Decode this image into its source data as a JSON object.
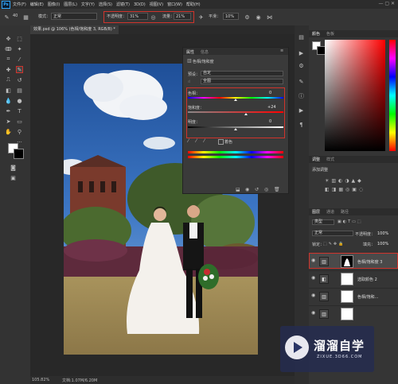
{
  "app_logo": "Ps",
  "menu": [
    "文件(F)",
    "编辑(E)",
    "图像(I)",
    "图层(L)",
    "文字(Y)",
    "选择(S)",
    "滤镜(T)",
    "3D(D)",
    "视图(V)",
    "窗口(W)",
    "帮助(H)"
  ],
  "options": {
    "brush_size": "40",
    "mode_label": "模式：",
    "mode_value": "正常",
    "opacity_label": "不透明度：",
    "opacity_value": "31%",
    "flow_label": "流量：",
    "flow_value": "21%",
    "smooth_label": "平滑：",
    "smooth_value": "10%"
  },
  "document": {
    "tab_title": "效果.psd @ 106% (色相/饱和度 3, RGB/8) *",
    "zoom": "105.82%",
    "doc_size": "文档:1.07M/6.20M"
  },
  "hue_panel": {
    "tab_properties": "属性",
    "tab_info": "信息",
    "title": "色相/饱和度",
    "preset_label": "预设：",
    "preset_value": "自定",
    "channel_value": "全图",
    "hue_label": "色相：",
    "hue_value": "0",
    "saturation_label": "饱和度：",
    "saturation_value": "+24",
    "lightness_label": "明度：",
    "lightness_value": "0",
    "colorize_label": "着色"
  },
  "right_panels": {
    "color_tabs": [
      "颜色",
      "色板"
    ],
    "adjust_tabs": [
      "调整",
      "样式"
    ],
    "add_adjustment_label": "添加调整",
    "layers_tabs": [
      "图层",
      "通道",
      "路径"
    ],
    "kind_label": "类型",
    "blend_mode": "正常",
    "layer_opacity_label": "不透明度：",
    "layer_opacity": "100%",
    "lock_label": "锁定：",
    "fill_label": "填充：",
    "fill_value": "100%"
  },
  "layers": [
    {
      "name": "色相/饱和度 3",
      "type": "adjust",
      "selected": true
    },
    {
      "name": "选取颜色 2",
      "type": "adjust",
      "selected": false
    },
    {
      "name": "色相/饱和...",
      "type": "adjust",
      "selected": false
    },
    {
      "name": "",
      "type": "adjust",
      "selected": false
    }
  ],
  "watermark": {
    "brand": "溜溜自学",
    "url": "ZIXUE.3D66.COM"
  },
  "colors": {
    "accent_red": "#d0342c",
    "ps_blue": "#31a8ff",
    "panel_bg": "#353535"
  }
}
